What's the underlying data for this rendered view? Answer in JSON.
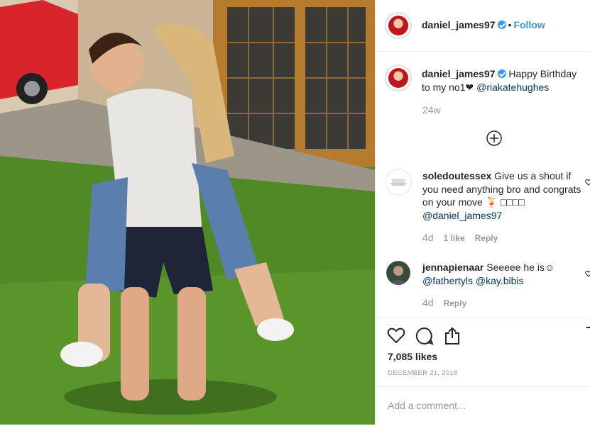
{
  "post": {
    "photo_alt": "",
    "username": "daniel_james97",
    "follow_label": "Follow",
    "separator": "•",
    "caption_text": "Happy Birthday to my no1❤",
    "caption_mention": "@riakatehughes",
    "caption_age": "24w"
  },
  "comments": [
    {
      "username": "soledoutessex",
      "text": "Give us a shout if you need anything bro and congrats on your move",
      "symbols": "🍹 □□□□",
      "mention": "@daniel_james97",
      "age": "4d",
      "likes": "1 like",
      "reply": "Reply"
    },
    {
      "username": "jennapienaar",
      "text": "Seeeee he is☺",
      "mention": "@fathertyls @kay.bibis",
      "age": "4d",
      "reply": "Reply"
    }
  ],
  "footer": {
    "likes": "7,085 likes",
    "date": "DECEMBER 21, 2018",
    "add_comment_placeholder": "Add a comment..."
  },
  "colors": {
    "link": "#3897f0",
    "mention": "#003569",
    "muted": "#999999"
  },
  "icons": [
    "verified-icon",
    "add-circle-icon",
    "like-icon",
    "comment-icon",
    "share-icon",
    "save-icon"
  ]
}
